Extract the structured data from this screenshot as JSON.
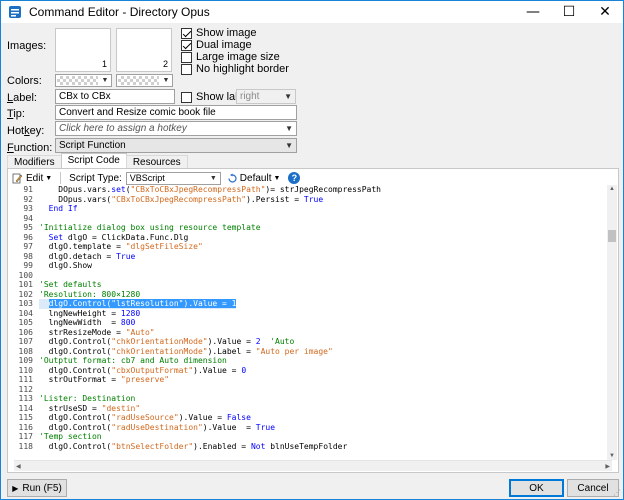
{
  "window": {
    "title": "Command Editor - Directory Opus",
    "icon": "directory-opus-icon",
    "minimize": "—",
    "maximize": "☐",
    "close": "✕"
  },
  "labels": {
    "images": "Images:",
    "colors": "Colors:",
    "label": "Label:",
    "tip": "Tip:",
    "hotkey": "Hotkey:",
    "function": "Function:"
  },
  "images": {
    "slot1": "1",
    "slot2": "2"
  },
  "image_options": {
    "show_image": {
      "label": "Show image",
      "checked": true
    },
    "dual_image": {
      "label": "Dual image",
      "checked": true
    },
    "large_image_size": {
      "label": "Large image size",
      "checked": false
    },
    "no_highlight_border": {
      "label": "No highlight border",
      "checked": false
    }
  },
  "fields": {
    "label_value": "CBx to CBx",
    "show_label": "Show label",
    "show_label_position": "right",
    "tip_value": "Convert and Resize comic book file",
    "hotkey_placeholder": "Click here to assign a hotkey",
    "function_value": "Script Function"
  },
  "tabs": [
    "Modifiers",
    "Script Code",
    "Resources"
  ],
  "toolbar": {
    "edit": "Edit",
    "script_type_label": "Script Type:",
    "script_type_value": "VBScript",
    "default": "Default",
    "help": "?"
  },
  "code_lines": [
    {
      "n": "91",
      "html": "    DOpus.vars.<span class=\"kw\">set</span>(<span class=\"str\">\"CBxToCBxJpegRecompressPath\"</span>)= strJpegRecompressPath"
    },
    {
      "n": "92",
      "html": "    DOpus.vars(<span class=\"str\">\"CBxToCBxJpegRecompressPath\"</span>).Persist = <span class=\"kw\">True</span>"
    },
    {
      "n": "93",
      "html": "  <span class=\"kw\">End If</span>"
    },
    {
      "n": "94",
      "html": ""
    },
    {
      "n": "95",
      "html": "<span class=\"cm\">'Initialize dialog box using resource template</span>"
    },
    {
      "n": "96",
      "html": "  <span class=\"kw\">Set</span> dlgO = ClickData.Func.Dlg"
    },
    {
      "n": "97",
      "html": "  dlgO.template = <span class=\"str\">\"dlgSetFileSize\"</span>"
    },
    {
      "n": "98",
      "html": "  dlgO.detach = <span class=\"kw\">True</span>"
    },
    {
      "n": "99",
      "html": "  dlgO.Show"
    },
    {
      "n": "100",
      "html": ""
    },
    {
      "n": "101",
      "html": "<span class=\"cm\">'Set defaults</span>"
    },
    {
      "n": "102",
      "html": "<span class=\"cm\">'Resolution: 800×1280</span>"
    },
    {
      "n": "103",
      "html": "  <span class=\"sel\">dlgO.Control(\"lstResolution\").Value = 1</span>",
      "highlight": true
    },
    {
      "n": "104",
      "html": "  lngNewHeight = <span class=\"num\">1280</span>"
    },
    {
      "n": "105",
      "html": "  lngNewWidth  = <span class=\"num\">800</span>"
    },
    {
      "n": "106",
      "html": "  strResizeMode = <span class=\"str\">\"Auto\"</span>"
    },
    {
      "n": "107",
      "html": "  dlgO.Control(<span class=\"str\">\"chkOrientationMode\"</span>).Value = <span class=\"num\">2</span>  <span class=\"cm\">'Auto</span>"
    },
    {
      "n": "108",
      "html": "  dlgO.Control(<span class=\"str\">\"chkOrientationMode\"</span>).Label = <span class=\"str\">\"Auto per image\"</span>"
    },
    {
      "n": "109",
      "html": "<span class=\"cm\">'Outptut format: cb7 and Auto dimension</span>"
    },
    {
      "n": "110",
      "html": "  dlgO.Control(<span class=\"str\">\"cbxOutputFormat\"</span>).Value = <span class=\"num\">0</span>"
    },
    {
      "n": "111",
      "html": "  strOutFormat = <span class=\"str\">\"preserve\"</span>"
    },
    {
      "n": "112",
      "html": ""
    },
    {
      "n": "113",
      "html": "<span class=\"cm\">'Lister: Destination</span>"
    },
    {
      "n": "114",
      "html": "  strUseSD = <span class=\"str\">\"destin\"</span>"
    },
    {
      "n": "115",
      "html": "  dlgO.Control(<span class=\"str\">\"radUseSource\"</span>).Value = <span class=\"kw\">False</span>"
    },
    {
      "n": "116",
      "html": "  dlgO.Control(<span class=\"str\">\"radUseDestination\"</span>).Value  = <span class=\"kw\">True</span>"
    },
    {
      "n": "117",
      "html": "<span class=\"cm\">'Temp section</span>"
    },
    {
      "n": "118",
      "html": "  dlgO.Control(<span class=\"str\">\"btnSelectFolder\"</span>).Enabled = <span class=\"kw\">Not</span> blnUseTempFolder"
    }
  ],
  "buttons": {
    "run": "Run (F5)",
    "ok": "OK",
    "cancel": "Cancel"
  },
  "colors": {
    "accent": "#0078d7",
    "selection": "#3399ff",
    "keyword": "#0000ff",
    "string": "#d2691e",
    "comment": "#008000"
  }
}
